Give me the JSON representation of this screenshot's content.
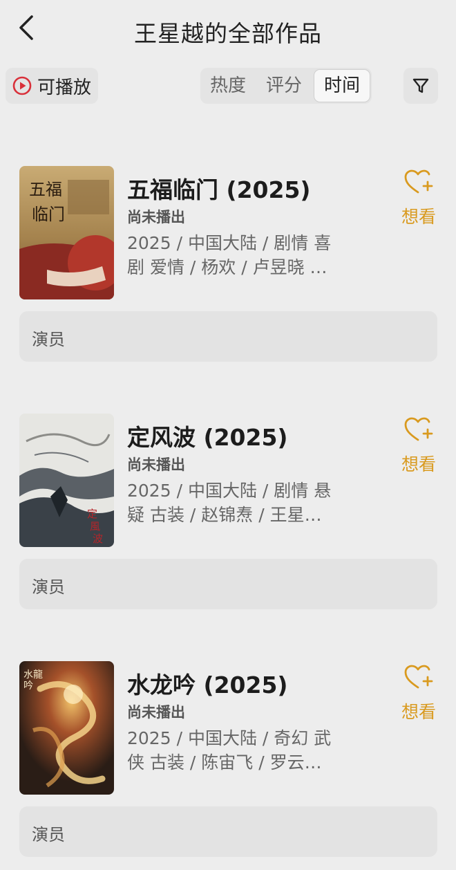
{
  "header": {
    "title": "王星越的全部作品"
  },
  "toolbar": {
    "playable_label": "可播放",
    "sort_tabs": [
      "热度",
      "评分",
      "时间"
    ],
    "active_sort": "时间"
  },
  "works": [
    {
      "title": "五福临门 (2025)",
      "status": "尚未播出",
      "meta": "2025 / 中国大陆 / 剧情 喜剧 爱情 / 杨欢 / 卢昱晓 …",
      "want_label": "想看",
      "role": "演员",
      "poster_text": "五福临门"
    },
    {
      "title": "定风波 (2025)",
      "status": "尚未播出",
      "meta": "2025 / 中国大陆 / 剧情 悬疑 古装 / 赵锦焘 / 王星…",
      "want_label": "想看",
      "role": "演员",
      "poster_text": "定风波"
    },
    {
      "title": "水龙吟 (2025)",
      "status": "尚未播出",
      "meta": "2025 / 中国大陆 / 奇幻 武侠 古装 / 陈宙飞 / 罗云…",
      "want_label": "想看",
      "role": "演员",
      "poster_text": "水龙吟"
    }
  ],
  "colors": {
    "accent": "#d99a1f",
    "play_icon": "#d9303a",
    "background": "#ededed"
  },
  "icons": {
    "back": "chevron-left-icon",
    "play": "play-circle-icon",
    "filter": "filter-icon",
    "want": "heart-plus-icon"
  }
}
